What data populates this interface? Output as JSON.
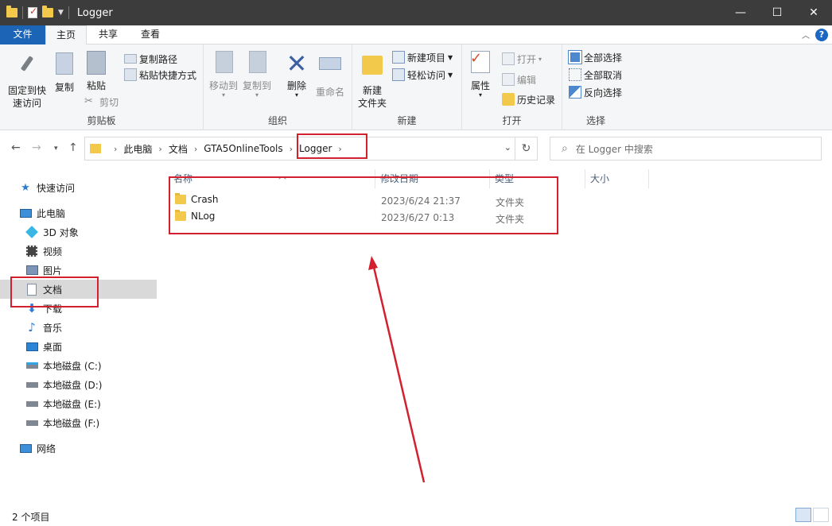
{
  "window": {
    "title": "Logger",
    "minimize": "—",
    "maximize": "☐",
    "close": "✕"
  },
  "tabs": {
    "file": "文件",
    "home": "主页",
    "share": "共享",
    "view": "查看",
    "help": "?"
  },
  "ribbon": {
    "clipboard": {
      "label": "剪贴板",
      "pin": "固定到快速访问",
      "pin_line1": "固定到快",
      "pin_line2": "速访问",
      "copy": "复制",
      "paste": "粘贴",
      "copy_path": "复制路径",
      "paste_shortcut": "粘贴快捷方式",
      "cut": "剪切"
    },
    "organize": {
      "label": "组织",
      "move_to": "移动到",
      "copy_to": "复制到",
      "delete": "删除",
      "rename": "重命名"
    },
    "new": {
      "label": "新建",
      "new_item": "新建项目",
      "easy_access": "轻松访问",
      "new_folder_line1": "新建",
      "new_folder_line2": "文件夹"
    },
    "open": {
      "label": "打开",
      "properties": "属性",
      "open": "打开",
      "edit": "编辑",
      "history": "历史记录"
    },
    "select": {
      "label": "选择",
      "select_all": "全部选择",
      "select_none": "全部取消",
      "invert": "反向选择"
    }
  },
  "address": {
    "crumbs": [
      "此电脑",
      "文档",
      "GTA5OnlineTools",
      "Logger"
    ],
    "search_placeholder": "在 Logger 中搜索"
  },
  "sidebar": {
    "quick_access": "快速访问",
    "this_pc": "此电脑",
    "items": [
      "3D 对象",
      "视频",
      "图片",
      "文档",
      "下载",
      "音乐",
      "桌面",
      "本地磁盘 (C:)",
      "本地磁盘 (D:)",
      "本地磁盘 (E:)",
      "本地磁盘 (F:)"
    ],
    "network": "网络"
  },
  "columns": {
    "name": "名称",
    "modified": "修改日期",
    "type": "类型",
    "size": "大小"
  },
  "files": [
    {
      "name": "Crash",
      "modified": "2023/6/24 21:37",
      "type": "文件夹"
    },
    {
      "name": "NLog",
      "modified": "2023/6/27 0:13",
      "type": "文件夹"
    }
  ],
  "status": {
    "count": "2 个项目"
  },
  "colors": {
    "annotation": "#d2202e",
    "file_tab": "#1c65b6",
    "folder": "#f3c94c"
  }
}
